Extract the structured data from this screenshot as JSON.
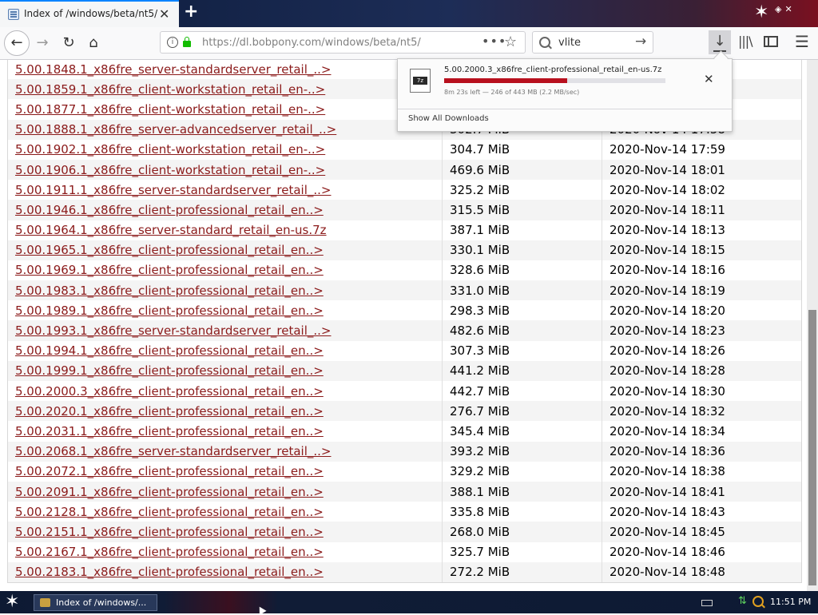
{
  "browser": {
    "tab_title": "Index of /windows/beta/nt5/",
    "tab_close": "✕",
    "new_tab": "+",
    "url": "https://dl.bobpony.com/windows/beta/nt5/",
    "search_value": "vlite",
    "icons": {
      "back": "←",
      "forward": "→",
      "reload": "↻",
      "home": "⌂",
      "page_actions": "•••",
      "bookmark": "☆",
      "search_go": "→",
      "download": "↓",
      "library": "|||\\",
      "menu": "☰"
    }
  },
  "downloads": {
    "file_name": "5.00.2000.3_x86fre_client-professional_retail_en-us.7z",
    "status": "8m 23s left — 246 of 443 MB (2.2 MB/sec)",
    "progress_fraction": 0.555,
    "cancel": "✕",
    "show_all": "Show All Downloads"
  },
  "listing": {
    "rows": [
      {
        "name": "5.00.1848.1_x86fre_server-standardserver_retail_..>",
        "size": "",
        "date": ""
      },
      {
        "name": "5.00.1859.1_x86fre_client-workstation_retail_en-..>",
        "size": "",
        "date": ""
      },
      {
        "name": "5.00.1877.1_x86fre_client-workstation_retail_en-..>",
        "size": "",
        "date": ""
      },
      {
        "name": "5.00.1888.1_x86fre_server-advancedserver_retail_..>",
        "size": "302.7 MiB",
        "date": "2020-Nov-14 17:58"
      },
      {
        "name": "5.00.1902.1_x86fre_client-workstation_retail_en-..>",
        "size": "304.7 MiB",
        "date": "2020-Nov-14 17:59"
      },
      {
        "name": "5.00.1906.1_x86fre_client-workstation_retail_en-..>",
        "size": "469.6 MiB",
        "date": "2020-Nov-14 18:01"
      },
      {
        "name": "5.00.1911.1_x86fre_server-standardserver_retail_..>",
        "size": "325.2 MiB",
        "date": "2020-Nov-14 18:02"
      },
      {
        "name": "5.00.1946.1_x86fre_client-professional_retail_en..>",
        "size": "315.5 MiB",
        "date": "2020-Nov-14 18:11"
      },
      {
        "name": "5.00.1964.1_x86fre_server-standard_retail_en-us.7z",
        "size": "387.1 MiB",
        "date": "2020-Nov-14 18:13"
      },
      {
        "name": "5.00.1965.1_x86fre_client-professional_retail_en..>",
        "size": "330.1 MiB",
        "date": "2020-Nov-14 18:15"
      },
      {
        "name": "5.00.1969.1_x86fre_client-professional_retail_en..>",
        "size": "328.6 MiB",
        "date": "2020-Nov-14 18:16"
      },
      {
        "name": "5.00.1983.1_x86fre_client-professional_retail_en..>",
        "size": "331.0 MiB",
        "date": "2020-Nov-14 18:19"
      },
      {
        "name": "5.00.1989.1_x86fre_client-professional_retail_en..>",
        "size": "298.3 MiB",
        "date": "2020-Nov-14 18:20"
      },
      {
        "name": "5.00.1993.1_x86fre_server-standardserver_retail_..>",
        "size": "482.6 MiB",
        "date": "2020-Nov-14 18:23"
      },
      {
        "name": "5.00.1994.1_x86fre_client-professional_retail_en..>",
        "size": "307.3 MiB",
        "date": "2020-Nov-14 18:26"
      },
      {
        "name": "5.00.1999.1_x86fre_client-professional_retail_en..>",
        "size": "441.2 MiB",
        "date": "2020-Nov-14 18:28"
      },
      {
        "name": "5.00.2000.3_x86fre_client-professional_retail_en..>",
        "size": "442.7 MiB",
        "date": "2020-Nov-14 18:30"
      },
      {
        "name": "5.00.2020.1_x86fre_client-professional_retail_en..>",
        "size": "276.7 MiB",
        "date": "2020-Nov-14 18:32"
      },
      {
        "name": "5.00.2031.1_x86fre_client-professional_retail_en..>",
        "size": "345.4 MiB",
        "date": "2020-Nov-14 18:34"
      },
      {
        "name": "5.00.2068.1_x86fre_server-standardserver_retail_..>",
        "size": "393.2 MiB",
        "date": "2020-Nov-14 18:36"
      },
      {
        "name": "5.00.2072.1_x86fre_client-professional_retail_en..>",
        "size": "329.2 MiB",
        "date": "2020-Nov-14 18:38"
      },
      {
        "name": "5.00.2091.1_x86fre_client-professional_retail_en..>",
        "size": "388.1 MiB",
        "date": "2020-Nov-14 18:41"
      },
      {
        "name": "5.00.2128.1_x86fre_client-professional_retail_en..>",
        "size": "335.8 MiB",
        "date": "2020-Nov-14 18:43"
      },
      {
        "name": "5.00.2151.1_x86fre_client-professional_retail_en..>",
        "size": "268.0 MiB",
        "date": "2020-Nov-14 18:45"
      },
      {
        "name": "5.00.2167.1_x86fre_client-professional_retail_en..>",
        "size": "325.7 MiB",
        "date": "2020-Nov-14 18:46"
      },
      {
        "name": "5.00.2183.1_x86fre_client-professional_retail_en..>",
        "size": "272.2 MiB",
        "date": "2020-Nov-14 18:48"
      }
    ]
  },
  "taskbar": {
    "start_icon": "✶",
    "window_label": "Index of /windows/...",
    "clock": "11:51 PM"
  },
  "colors": {
    "link": "#8b1a1a",
    "progress": "#b8101e",
    "accent": "#0a84ff"
  }
}
